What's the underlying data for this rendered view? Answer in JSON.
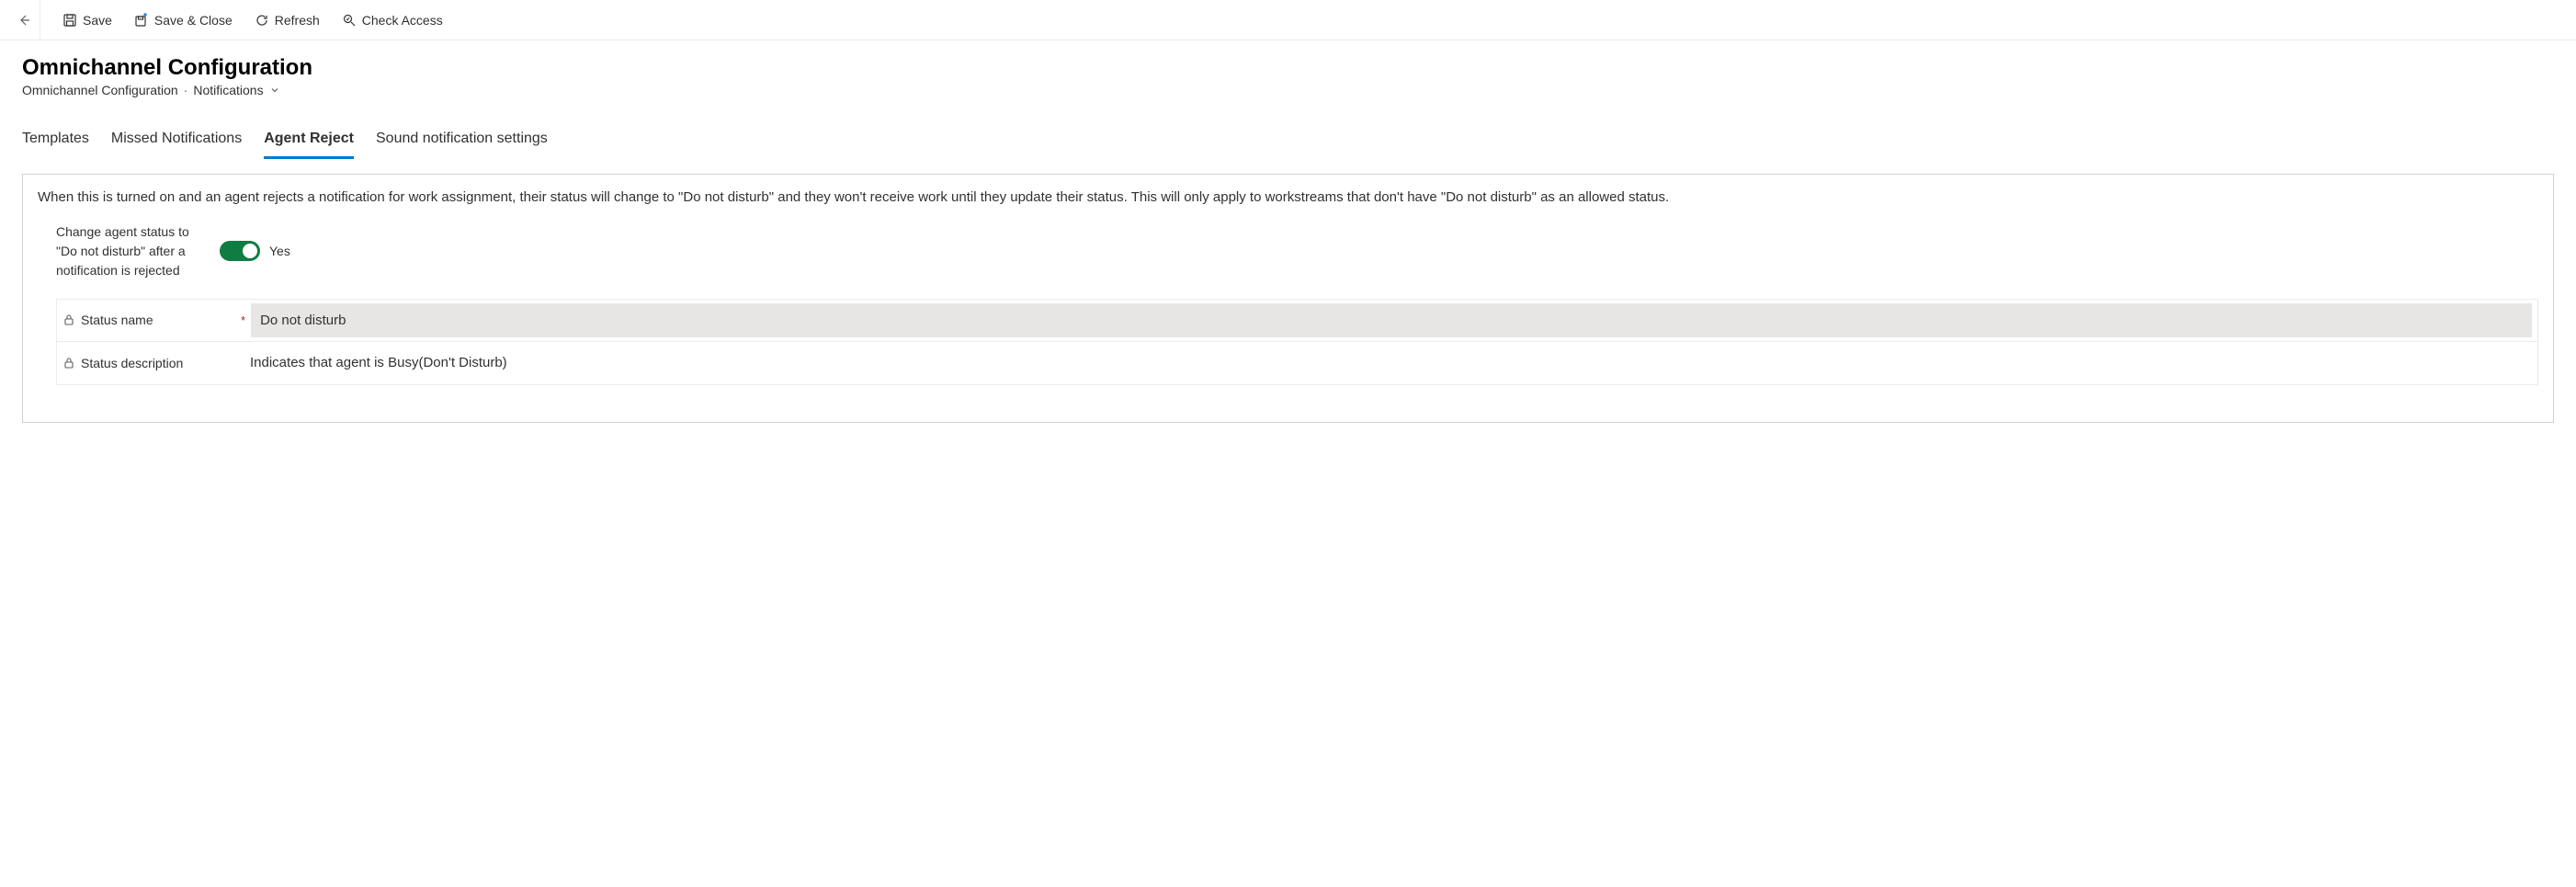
{
  "toolbar": {
    "save_label": "Save",
    "save_close_label": "Save & Close",
    "refresh_label": "Refresh",
    "check_access_label": "Check Access"
  },
  "header": {
    "title": "Omnichannel Configuration"
  },
  "breadcrumb": {
    "entity": "Omnichannel Configuration",
    "view": "Notifications"
  },
  "tabs": [
    {
      "label": "Templates"
    },
    {
      "label": "Missed Notifications"
    },
    {
      "label": "Agent Reject"
    },
    {
      "label": "Sound notification settings"
    }
  ],
  "panel": {
    "description": "When this is turned on and an agent rejects a notification for work assignment, their status will change to \"Do not disturb\" and they won't receive work until they update their status. This will only apply to workstreams that don't have \"Do not disturb\" as an allowed status.",
    "toggle": {
      "label": "Change agent status to \"Do not disturb\" after a notification is rejected",
      "value_text": "Yes"
    },
    "fields": {
      "status_name": {
        "label": "Status name",
        "required": "*",
        "value": "Do not disturb"
      },
      "status_description": {
        "label": "Status description",
        "value": "Indicates that agent is Busy(Don't Disturb)"
      }
    }
  }
}
